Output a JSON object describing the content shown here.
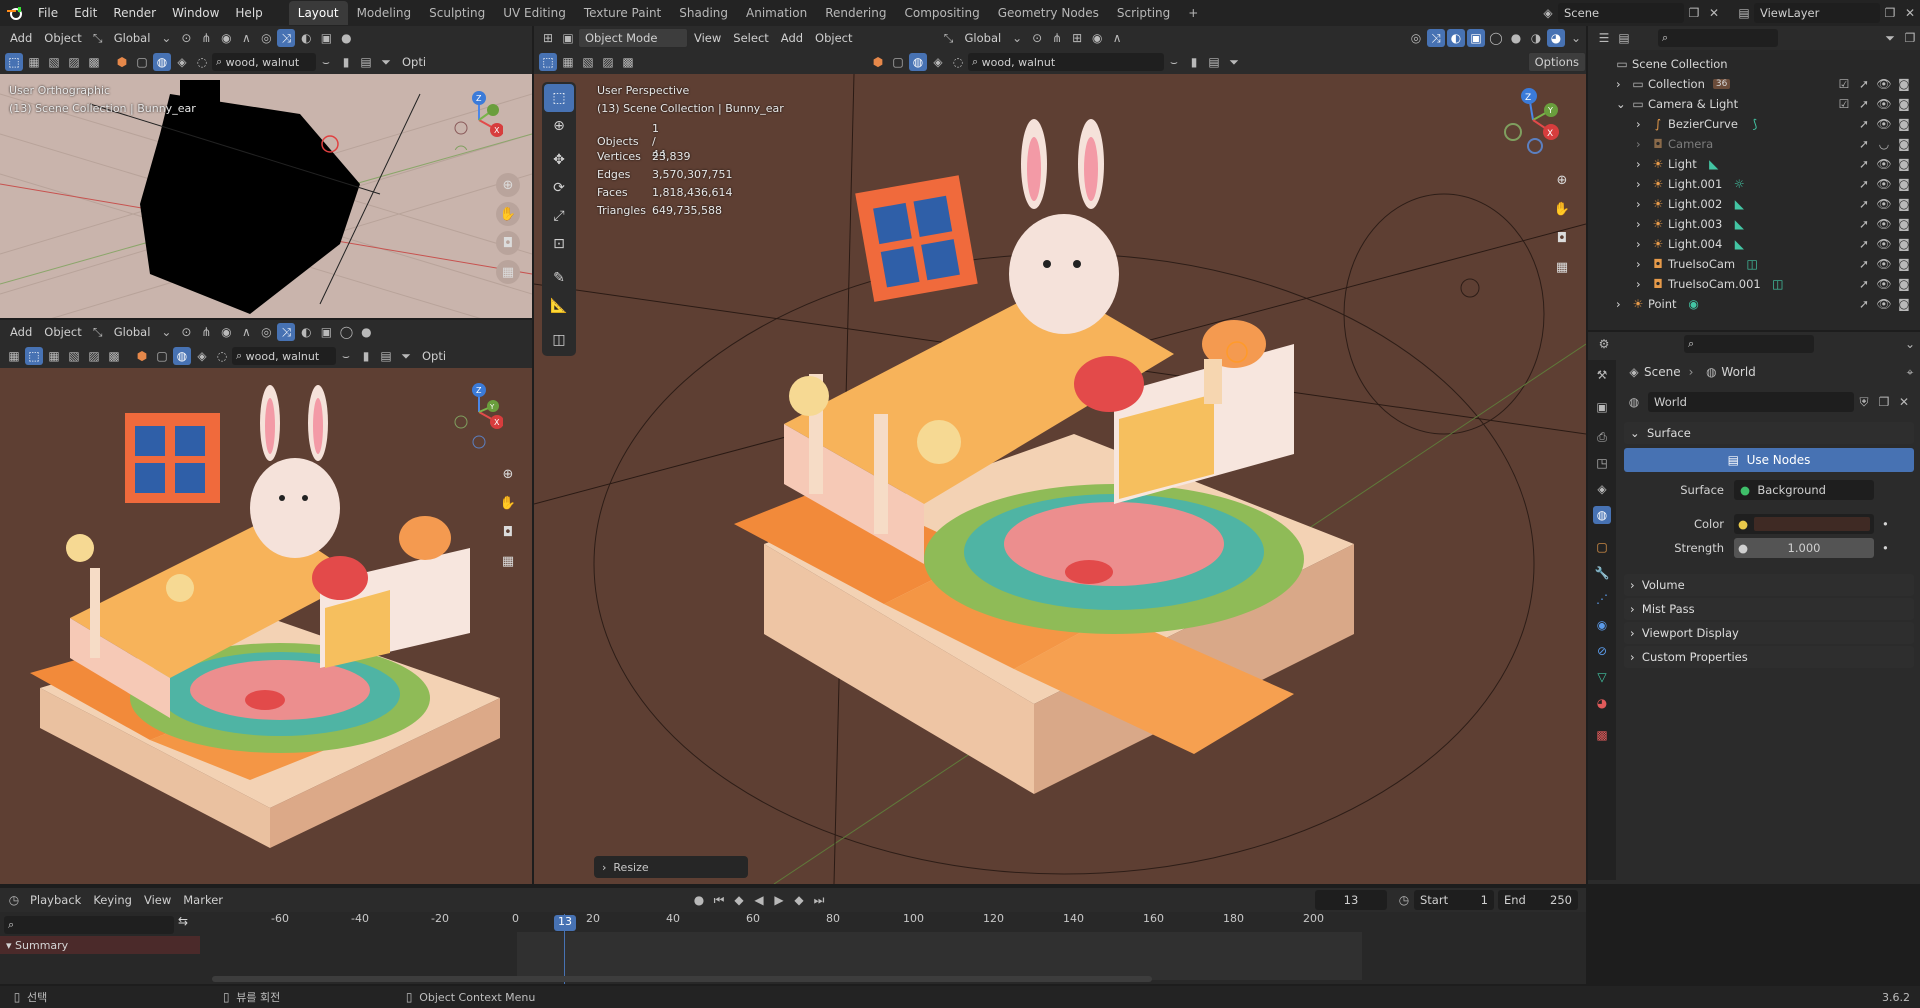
{
  "topbar": {
    "menus": [
      "File",
      "Edit",
      "Render",
      "Window",
      "Help"
    ],
    "workspaces": [
      "Layout",
      "Modeling",
      "Sculpting",
      "UV Editing",
      "Texture Paint",
      "Shading",
      "Animation",
      "Rendering",
      "Compositing",
      "Geometry Nodes",
      "Scripting"
    ],
    "active_workspace": "Layout",
    "add_tab": "+",
    "scene": "Scene",
    "view_layer": "ViewLayer"
  },
  "small_vp_top": {
    "menus": [
      "Add",
      "Object"
    ],
    "orientation": "Global",
    "filter": "wood, walnut",
    "options": "Opti",
    "info_line1": "User Orthographic",
    "info_line2": "(13) Scene Collection | Bunny_ear"
  },
  "small_vp_bottom": {
    "menus": [
      "Add",
      "Object"
    ],
    "orientation": "Global",
    "filter": "wood, walnut",
    "options": "Opti"
  },
  "main_vp": {
    "mode": "Object Mode",
    "menus": [
      "View",
      "Select",
      "Add",
      "Object"
    ],
    "orientation": "Global",
    "filter": "wood, walnut",
    "options": "Options",
    "info_line1": "User Perspective",
    "info_line2": "(13) Scene Collection | Bunny_ear",
    "stats": [
      {
        "label": "Objects",
        "value": "1 / 44"
      },
      {
        "label": "Vertices",
        "value": "23,839"
      },
      {
        "label": "Edges",
        "value": "3,570,307,751"
      },
      {
        "label": "Faces",
        "value": "1,818,436,614"
      },
      {
        "label": "Triangles",
        "value": "649,735,588"
      }
    ],
    "last_op": "Resize"
  },
  "outliner": {
    "root": "Scene Collection",
    "items": [
      {
        "name": "Collection",
        "indent": 1
      },
      {
        "name": "Camera & Light",
        "indent": 1
      },
      {
        "name": "BezierCurve",
        "indent": 2
      },
      {
        "name": "Camera",
        "indent": 2
      },
      {
        "name": "Light",
        "indent": 2
      },
      {
        "name": "Light.001",
        "indent": 2
      },
      {
        "name": "Light.002",
        "indent": 2
      },
      {
        "name": "Light.003",
        "indent": 2
      },
      {
        "name": "Light.004",
        "indent": 2
      },
      {
        "name": "TrueIsoCam",
        "indent": 2
      },
      {
        "name": "TrueIsoCam.001",
        "indent": 2
      },
      {
        "name": "Point",
        "indent": 1
      }
    ],
    "collection_badge": "36"
  },
  "properties": {
    "breadcrumb_scene": "Scene",
    "breadcrumb_world": "World",
    "world_name": "World",
    "surface_panel": "Surface",
    "use_nodes": "Use Nodes",
    "surface_label": "Surface",
    "surface_value": "Background",
    "color_label": "Color",
    "strength_label": "Strength",
    "strength_value": "1.000",
    "panels": [
      "Volume",
      "Mist Pass",
      "Viewport Display",
      "Custom Properties"
    ],
    "world_color": "#3f2a24"
  },
  "timeline": {
    "menus": [
      "Playback",
      "Keying",
      "View",
      "Marker"
    ],
    "current_frame": "13",
    "start_label": "Start",
    "start": "1",
    "end_label": "End",
    "end": "250",
    "ticks": [
      "-60",
      "-40",
      "-20",
      "0",
      "20",
      "40",
      "60",
      "80",
      "100",
      "120",
      "140",
      "160",
      "180",
      "200"
    ],
    "summary": "Summary"
  },
  "statusbar": {
    "left": "선택",
    "middle": "뷰를 회전",
    "right_hint": "Object Context Menu",
    "version": "3.6.2"
  },
  "colors": {
    "accent": "#4772b3",
    "viewport_bg": "#5e3f33",
    "top_vp_bg": "#c9b4ac",
    "playhead": "#4772b3"
  }
}
